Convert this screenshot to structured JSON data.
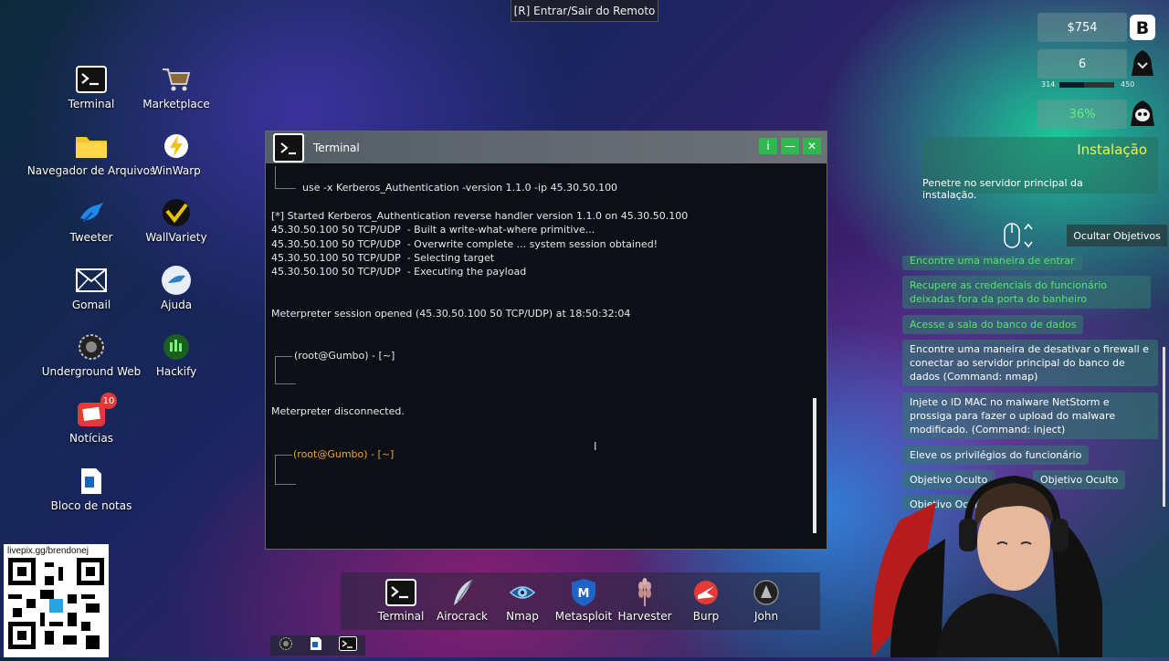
{
  "remote_label": "[R] Entrar/Sair do Remoto",
  "desktop_icons": [
    {
      "label": "Terminal",
      "icon": "terminal-icon"
    },
    {
      "label": "Marketplace",
      "icon": "cart-icon"
    },
    {
      "label": "Navegador de Arquivos",
      "icon": "folder-icon"
    },
    {
      "label": "WinWarp",
      "icon": "lightning-icon"
    },
    {
      "label": "Tweeter",
      "icon": "bird-icon"
    },
    {
      "label": "WallVariety",
      "icon": "wallvariety-icon"
    },
    {
      "label": "Gomail",
      "icon": "mail-icon"
    },
    {
      "label": "Ajuda",
      "icon": "help-icon"
    },
    {
      "label": "Underground Web",
      "icon": "underground-icon"
    },
    {
      "label": "Hackify",
      "icon": "hackify-icon"
    },
    {
      "label": "Notícias",
      "icon": "news-icon",
      "badge": "10"
    },
    {
      "label": "Bloco de notas",
      "icon": "notepad-icon"
    }
  ],
  "terminal": {
    "title": "Terminal",
    "buttons": {
      "info": "i",
      "minimize": "—",
      "close": "✕"
    },
    "lines": {
      "cmd": "use -x Kerberos_Authentication -version 1.1.0 -ip 45.30.50.100",
      "started": "[*] Started Kerberos_Authentication reverse handler version 1.1.0 on 45.30.50.100",
      "l1": "45.30.50.100 50 TCP/UDP  - Built a write-what-where primitive...",
      "l2": "45.30.50.100 50 TCP/UDP  - Overwrite complete ... system session obtained!",
      "l3": "45.30.50.100 50 TCP/UDP  - Selecting target",
      "l4": "45.30.50.100 50 TCP/UDP  - Executing the payload",
      "session": "Meterpreter session opened (45.30.50.100 50 TCP/UDP) at 18:50:32:04",
      "prompt1": "(root@Gumbo) - [~]",
      "disconnected": "Meterpreter disconnected.",
      "prompt2": "(root@Gumbo) - [~]"
    }
  },
  "stats": {
    "money": "$754",
    "level": "6",
    "xp_min": "314",
    "xp_max": "450",
    "xp_fill_fraction": 0.45,
    "detection": "36%"
  },
  "objectives": {
    "title": "Instalação",
    "description": "Penetre no servidor principal da instalação.",
    "hide_button": "Ocultar Objetivos",
    "items": [
      {
        "text": "Encontre uma maneira de entrar",
        "done": true
      },
      {
        "text": "Recupere as credenciais do funcionário deixadas fora da porta do banheiro",
        "done": true
      },
      {
        "text": "Acesse a sala do banco de dados",
        "done": true
      },
      {
        "text": "Encontre uma maneira de desativar o firewall e conectar ao servidor principal do banco de dados (Command: nmap)",
        "done": false
      },
      {
        "text": "Injete o ID MAC no malware NetStorm e prossiga para fazer o upload do malware modificado. (Command: inject)",
        "done": false
      },
      {
        "text": "Eleve os privilégios do funcionário",
        "done": false
      },
      {
        "text": "Objetivo Oculto",
        "done": false
      },
      {
        "text": "Objetivo Oculto",
        "done": false
      },
      {
        "text": "Objetivo Oculto",
        "done": false
      }
    ]
  },
  "taskbar": [
    {
      "label": "Terminal",
      "icon": "terminal-icon"
    },
    {
      "label": "Airocrack",
      "icon": "airocrack-icon"
    },
    {
      "label": "Nmap",
      "icon": "eye-icon"
    },
    {
      "label": "Metasploit",
      "icon": "metasploit-icon"
    },
    {
      "label": "Harvester",
      "icon": "wheat-icon"
    },
    {
      "label": "Burp",
      "icon": "burp-icon"
    },
    {
      "label": "John",
      "icon": "john-icon"
    }
  ],
  "qr": {
    "label": "livepix.gg/brendonej"
  },
  "colors": {
    "accent_green": "#2fb84f",
    "done_green": "#54e66c",
    "prompt_orange": "#f0a437",
    "objective_title": "#f5f24a"
  }
}
